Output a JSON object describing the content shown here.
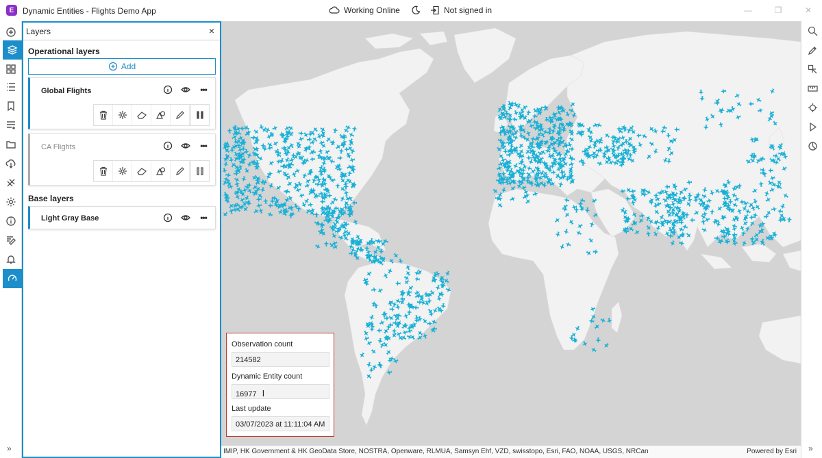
{
  "app": {
    "logo": "E",
    "title": "Dynamic Entities - Flights Demo App",
    "status": "Working Online",
    "signin": "Not signed in",
    "accent": "#1c8ec9"
  },
  "left_toolbar": {
    "icons": [
      "add-icon",
      "layers-icon",
      "basemap-gallery-icon",
      "legend-icon",
      "bookmark-icon",
      "table-icon",
      "folder-icon",
      "download-icon",
      "route-icon",
      "settings-icon",
      "info-icon",
      "edit-icon",
      "bell-icon",
      "speed-icon"
    ],
    "expand": "»"
  },
  "panel": {
    "title": "Layers",
    "close": "×",
    "operational_title": "Operational layers",
    "add_label": "Add",
    "layers": [
      {
        "name": "Global Flights",
        "active": true
      },
      {
        "name": "CA Flights",
        "active": false
      }
    ],
    "base_title": "Base layers",
    "base_layer": "Light Gray Base",
    "more": "•••"
  },
  "stats": {
    "obs_label": "Observation count",
    "obs_value": "214582",
    "entity_label": "Dynamic Entity count",
    "entity_value": "16977",
    "update_label": "Last update",
    "update_value": "03/07/2023 at 11:11:04 AM"
  },
  "map": {
    "attribution": "IMIP, HK Government & HK GeoData Store, NOSTRA, Openware, RLMUA, Samsyn Ehf, VZD, swisstopo, Esri, FAO, NOAA, USGS, NRCan",
    "powered": "Powered by Esri",
    "land_color": "#f2f2f2",
    "water_color": "#d4d4d4",
    "plane_color": "#1ab0d6"
  },
  "right_toolbar": {
    "icons": [
      "search-icon",
      "sketch-icon",
      "select-icon",
      "measure-icon",
      "locate-icon",
      "play-icon",
      "time-icon"
    ],
    "collapse": "»"
  }
}
